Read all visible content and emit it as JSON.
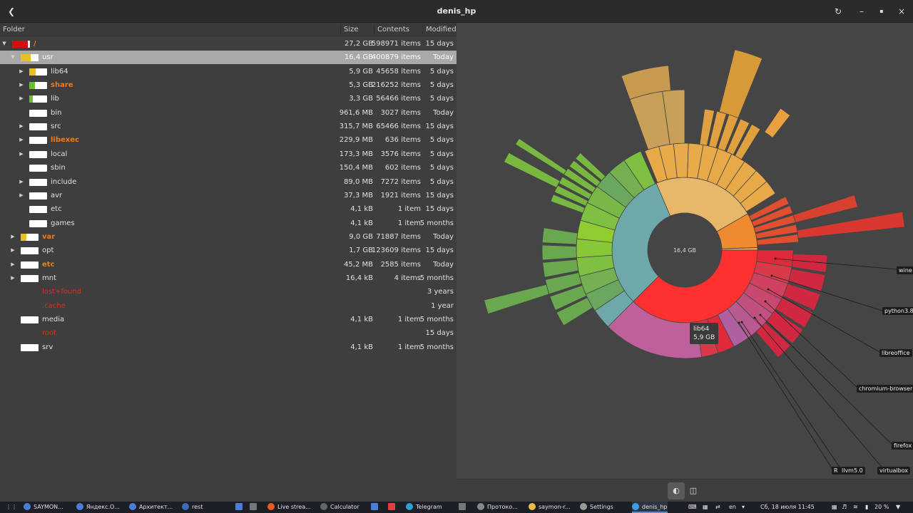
{
  "window": {
    "title": "denis_hp"
  },
  "table": {
    "headers": {
      "folder": "Folder",
      "size": "Size",
      "contents": "Contents",
      "modified": "Modified"
    },
    "rows": [
      {
        "name": "/",
        "size": "27,2 GB",
        "contents": "598971 items",
        "modified": "15 days"
      },
      {
        "name": "usr",
        "size": "16,4 GB",
        "contents": "400879 items",
        "modified": "Today"
      },
      {
        "name": "lib64",
        "size": "5,9 GB",
        "contents": "45658 items",
        "modified": "5 days"
      },
      {
        "name": "share",
        "size": "5,3 GB",
        "contents": "216252 items",
        "modified": "5 days"
      },
      {
        "name": "lib",
        "size": "3,3 GB",
        "contents": "56466 items",
        "modified": "5 days"
      },
      {
        "name": "bin",
        "size": "961,6 MB",
        "contents": "3027 items",
        "modified": "Today"
      },
      {
        "name": "src",
        "size": "315,7 MB",
        "contents": "65466 items",
        "modified": "15 days"
      },
      {
        "name": "libexec",
        "size": "229,9 MB",
        "contents": "636 items",
        "modified": "5 days"
      },
      {
        "name": "local",
        "size": "173,3 MB",
        "contents": "3576 items",
        "modified": "5 days"
      },
      {
        "name": "sbin",
        "size": "150,4 MB",
        "contents": "602 items",
        "modified": "5 days"
      },
      {
        "name": "include",
        "size": "89,0 MB",
        "contents": "7272 items",
        "modified": "5 days"
      },
      {
        "name": "avr",
        "size": "37,3 MB",
        "contents": "1921 items",
        "modified": "15 days"
      },
      {
        "name": "etc",
        "size": "4,1 kB",
        "contents": "1 item",
        "modified": "15 days"
      },
      {
        "name": "games",
        "size": "4,1 kB",
        "contents": "1 item",
        "modified": "5 months"
      },
      {
        "name": "var",
        "size": "9,0 GB",
        "contents": "71887 items",
        "modified": "Today"
      },
      {
        "name": "opt",
        "size": "1,7 GB",
        "contents": "123609 items",
        "modified": "15 days"
      },
      {
        "name": "etc",
        "size": "45,2 MB",
        "contents": "2585 items",
        "modified": "Today"
      },
      {
        "name": "mnt",
        "size": "16,4 kB",
        "contents": "4 items",
        "modified": "5 months"
      },
      {
        "name": "lost+found",
        "size": "",
        "contents": "",
        "modified": "3 years"
      },
      {
        "name": ".cache",
        "size": "",
        "contents": "",
        "modified": "1 year"
      },
      {
        "name": "media",
        "size": "4,1 kB",
        "contents": "1 item",
        "modified": "5 months"
      },
      {
        "name": "root",
        "size": "",
        "contents": "",
        "modified": "15 days"
      },
      {
        "name": "srv",
        "size": "4,1 kB",
        "contents": "1 item",
        "modified": "5 months"
      }
    ]
  },
  "chart": {
    "center_label": "16,4 GB",
    "tooltip": {
      "name": "lib64",
      "size": "5,9 GB"
    },
    "callouts": [
      "wine",
      "python3.8",
      "libreoffice",
      "chromium-browser",
      "firefox",
      "R",
      "llvm5.0",
      "virtualbox"
    ]
  },
  "taskbar": {
    "tasks": [
      "SAYMON...",
      "Яндекс.О...",
      "Архитект...",
      "rest",
      "Live strea...",
      "Calculator",
      "Telegram",
      "Протоко...",
      "saymon-r...",
      "Settings",
      "denis_hp"
    ],
    "lang": "en",
    "datetime": "Сб, 18 июля  11:45",
    "battery": "20 %"
  }
}
